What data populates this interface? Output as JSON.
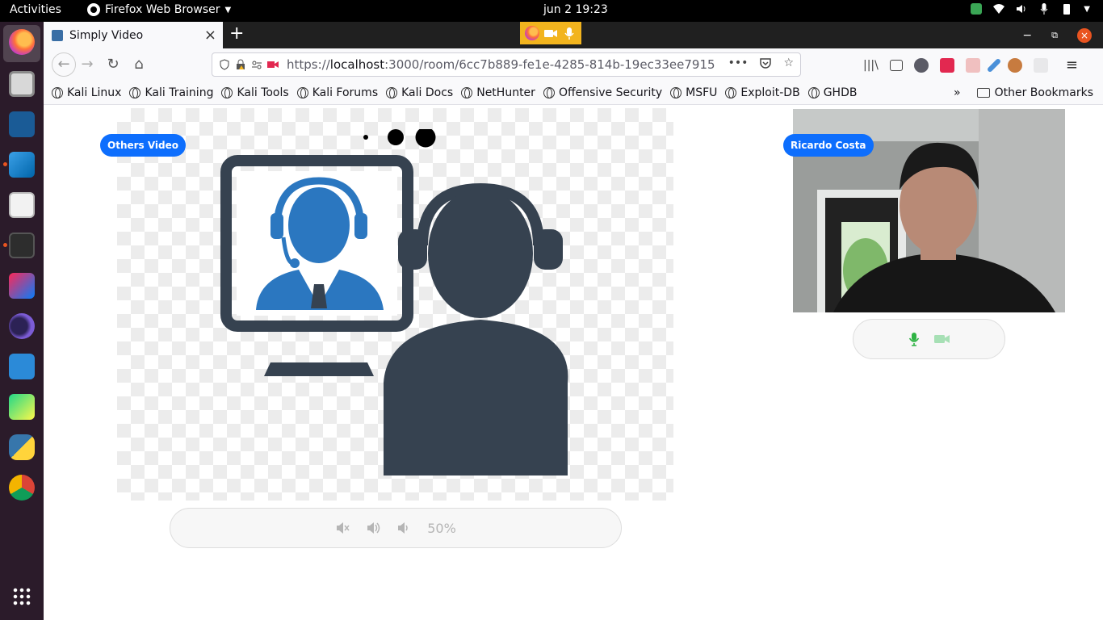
{
  "topbar": {
    "activities": "Activities",
    "app_name": "Firefox Web Browser",
    "clock": "jun 2  19:23"
  },
  "browser": {
    "tab_title": "Simply Video",
    "url_prefix": "https://",
    "url_host": "localhost",
    "url_rest": ":3000/room/6cc7b889-fe1e-4285-814b-19ec33ee7915",
    "bookmarks": [
      "Kali Linux",
      "Kali Training",
      "Kali Tools",
      "Kali Forums",
      "Kali Docs",
      "NetHunter",
      "Offensive Security",
      "MSFU",
      "Exploit-DB",
      "GHDB"
    ],
    "other_bookmarks": "Other Bookmarks",
    "sharing_colors": {
      "bg": "#f2b41e"
    }
  },
  "page": {
    "others_badge": "Others Video",
    "self_badge": "Ricardo Costa",
    "volume_label": "50%",
    "volume_level": 0.5,
    "accent": "#0d6efd",
    "mic_color": "#2fb344",
    "cam_color": "#a7e0b5"
  }
}
